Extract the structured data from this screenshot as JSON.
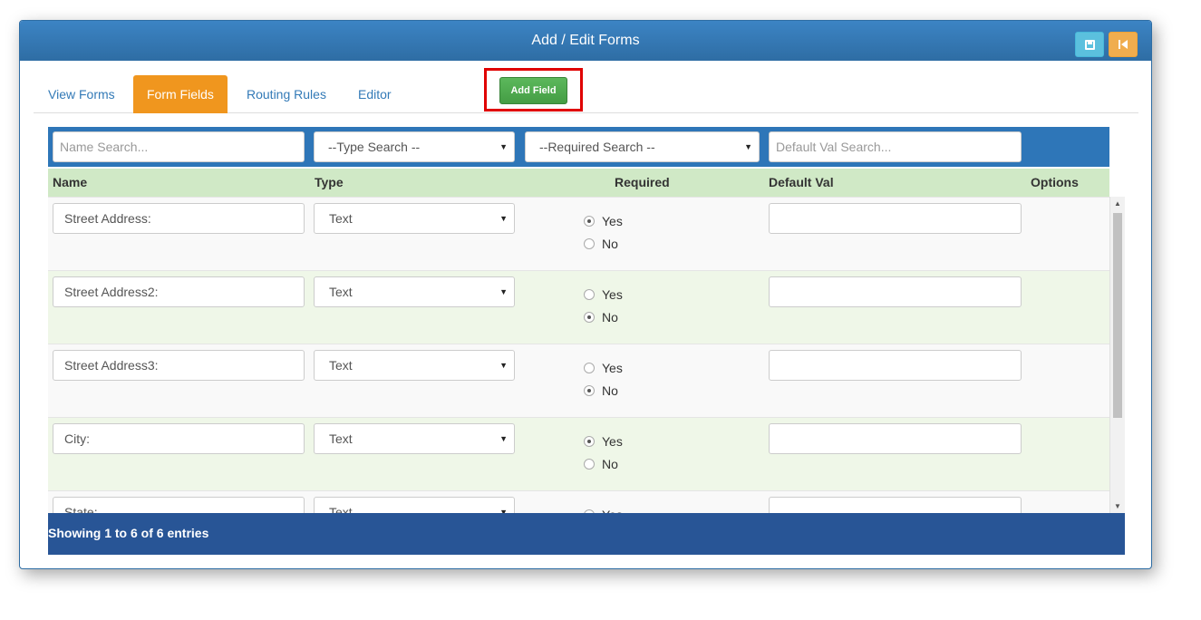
{
  "header": {
    "title": "Add / Edit Forms",
    "save_icon": "floppy-disk-icon",
    "back_icon": "step-backward-icon",
    "colors": {
      "primary": "#2e6da4",
      "info": "#5bc0de",
      "warning": "#f0ad4e"
    }
  },
  "tabs": [
    {
      "label": "View Forms",
      "active": false
    },
    {
      "label": "Form Fields",
      "active": true
    },
    {
      "label": "Routing Rules",
      "active": false
    },
    {
      "label": "Editor",
      "active": false
    }
  ],
  "add_field": {
    "label": "Add Field"
  },
  "filters": {
    "name_placeholder": "Name Search...",
    "type_selected": "--Type Search --",
    "required_selected": "--Required Search --",
    "default_placeholder": "Default Val Search..."
  },
  "columns": {
    "name": "Name",
    "type": "Type",
    "required": "Required",
    "default_val": "Default Val",
    "options": "Options"
  },
  "radio_labels": {
    "yes": "Yes",
    "no": "No"
  },
  "rows": [
    {
      "name": "Street Address:",
      "type": "Text",
      "required": "Yes",
      "default_val": ""
    },
    {
      "name": "Street Address2:",
      "type": "Text",
      "required": "No",
      "default_val": ""
    },
    {
      "name": "Street Address3:",
      "type": "Text",
      "required": "No",
      "default_val": ""
    },
    {
      "name": "City:",
      "type": "Text",
      "required": "Yes",
      "default_val": ""
    },
    {
      "name": "State:",
      "type": "Text",
      "required": "Yes",
      "default_val": ""
    }
  ],
  "footer": {
    "info": "Showing 1 to 6 of 6 entries"
  }
}
